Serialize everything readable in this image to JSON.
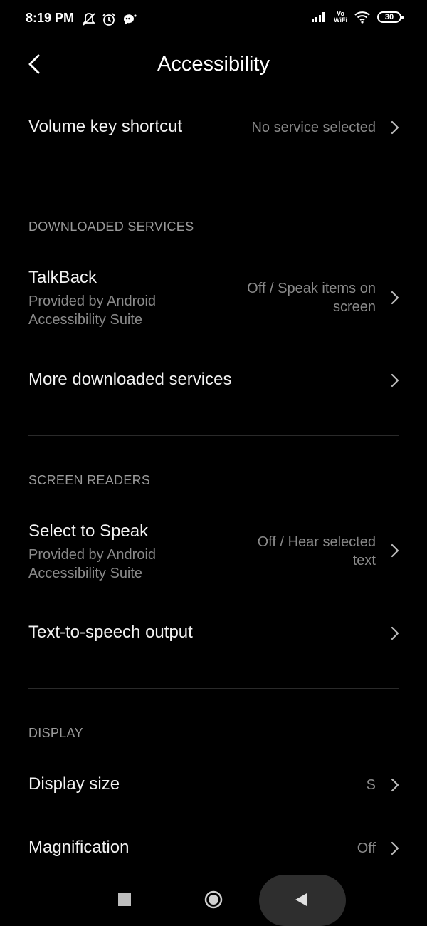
{
  "status": {
    "time": "8:19 PM",
    "vo": "Vo",
    "wifi_label": "WiFi",
    "battery": "30",
    "icons_left": [
      "mute-bell-icon",
      "alarm-icon",
      "chat-notification-icon"
    ],
    "icons_right": [
      "signal-icon",
      "wifi-icon",
      "battery-icon"
    ]
  },
  "header": {
    "title": "Accessibility",
    "back_icon": "back-arrow-icon"
  },
  "rows": {
    "volume_key": {
      "title": "Volume key shortcut",
      "value": "No service selected"
    },
    "talkback": {
      "title": "TalkBack",
      "sub1": "Provided by Android",
      "sub2": "Accessibility Suite",
      "value1": "Off / Speak items on",
      "value2": "screen"
    },
    "more_downloaded": {
      "title": "More downloaded services"
    },
    "select_to_speak": {
      "title": "Select to Speak",
      "sub1": "Provided by Android",
      "sub2": "Accessibility Suite",
      "value1": "Off / Hear selected",
      "value2": "text"
    },
    "tts_output": {
      "title": "Text-to-speech output"
    },
    "display_size": {
      "title": "Display size",
      "value": "S"
    },
    "magnification": {
      "title": "Magnification",
      "value": "Off"
    }
  },
  "sections": {
    "downloaded": "DOWNLOADED SERVICES",
    "screen_readers": "SCREEN READERS",
    "display": "DISPLAY"
  },
  "colors": {
    "background": "#000000",
    "text": "#f2f2f2",
    "secondary": "#8a8a8a",
    "divider": "#2a2a2a"
  }
}
